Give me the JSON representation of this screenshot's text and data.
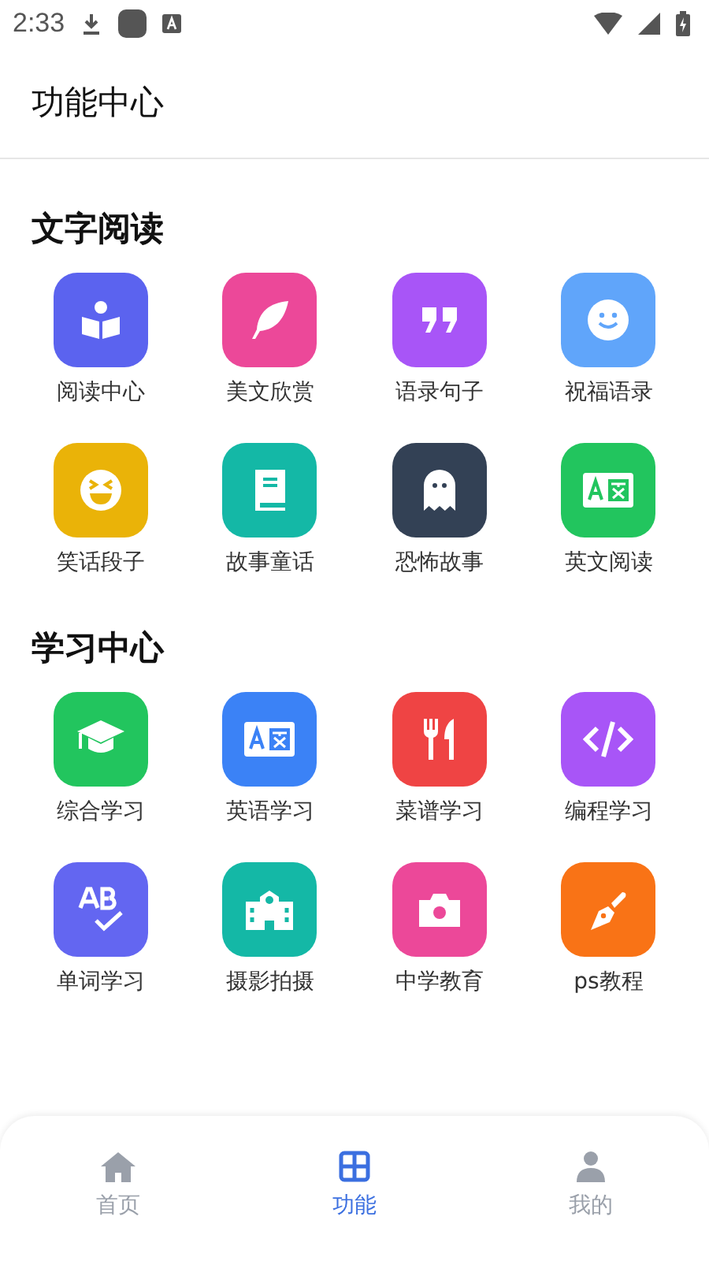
{
  "status_bar": {
    "time": "2:33"
  },
  "header": {
    "title": "功能中心"
  },
  "sections": [
    {
      "title": "文字阅读",
      "items": [
        {
          "label": "阅读中心",
          "color": "#5b63ef"
        },
        {
          "label": "美文欣赏",
          "color": "#ec4899"
        },
        {
          "label": "语录句子",
          "color": "#a855f7"
        },
        {
          "label": "祝福语录",
          "color": "#60a5fa"
        },
        {
          "label": "笑话段子",
          "color": "#eab308"
        },
        {
          "label": "故事童话",
          "color": "#14b8a6"
        },
        {
          "label": "恐怖故事",
          "color": "#334155"
        },
        {
          "label": "英文阅读",
          "color": "#22c55e"
        }
      ]
    },
    {
      "title": "学习中心",
      "items": [
        {
          "label": "综合学习",
          "color": "#22c55e"
        },
        {
          "label": "英语学习",
          "color": "#3b82f6"
        },
        {
          "label": "菜谱学习",
          "color": "#ef4444"
        },
        {
          "label": "编程学习",
          "color": "#a855f7"
        },
        {
          "label": "单词学习",
          "color": "#6366f1"
        },
        {
          "label": "摄影拍摄",
          "color": "#14b8a6"
        },
        {
          "label": "中学教育",
          "color": "#ec4899"
        },
        {
          "label": "ps教程",
          "color": "#f97316"
        }
      ]
    }
  ],
  "tabs": [
    {
      "label": "首页",
      "selected": false
    },
    {
      "label": "功能",
      "selected": true
    },
    {
      "label": "我的",
      "selected": false
    }
  ]
}
